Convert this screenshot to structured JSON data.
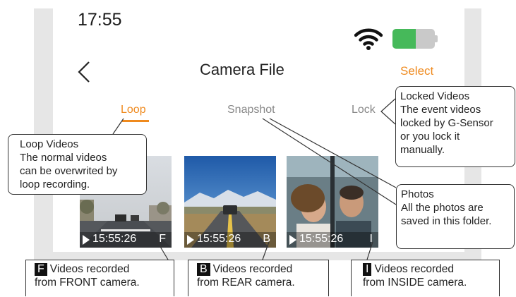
{
  "status_bar": {
    "time": "17:55",
    "battery_level": 0.55
  },
  "header": {
    "back_icon": "chevron-left-icon",
    "title": "Camera File",
    "select_label": "Select"
  },
  "tabs": [
    {
      "label": "Loop",
      "active": true
    },
    {
      "label": "Snapshot",
      "active": false
    },
    {
      "label": "Lock",
      "active": false
    }
  ],
  "thumbnails": [
    {
      "time": "15:55:26",
      "camera": "F"
    },
    {
      "time": "15:55:26",
      "camera": "B"
    },
    {
      "time": "15:55:26",
      "camera": "I"
    }
  ],
  "callouts": {
    "loop": {
      "heading": "Loop Videos",
      "lines": [
        "The normal videos",
        "can be overwrited by",
        "loop recording."
      ]
    },
    "lock": {
      "heading": "Locked Videos",
      "lines": [
        "The event videos",
        "locked by G-Sensor",
        "or you lock it",
        "manually."
      ]
    },
    "photos": {
      "heading": "Photos",
      "lines": [
        "All the photos are",
        "saved in this folder."
      ]
    }
  },
  "captions": [
    {
      "badge": "F",
      "line1": "Videos recorded",
      "line2": "from FRONT camera."
    },
    {
      "badge": "B",
      "line1": "Videos recorded",
      "line2": "from REAR camera."
    },
    {
      "badge": "I",
      "line1": "Videos recorded",
      "line2": "from INSIDE camera."
    }
  ],
  "colors": {
    "accent": "#ef8a1e",
    "battery": "#46b95a",
    "frame": "#e6e6e6"
  }
}
